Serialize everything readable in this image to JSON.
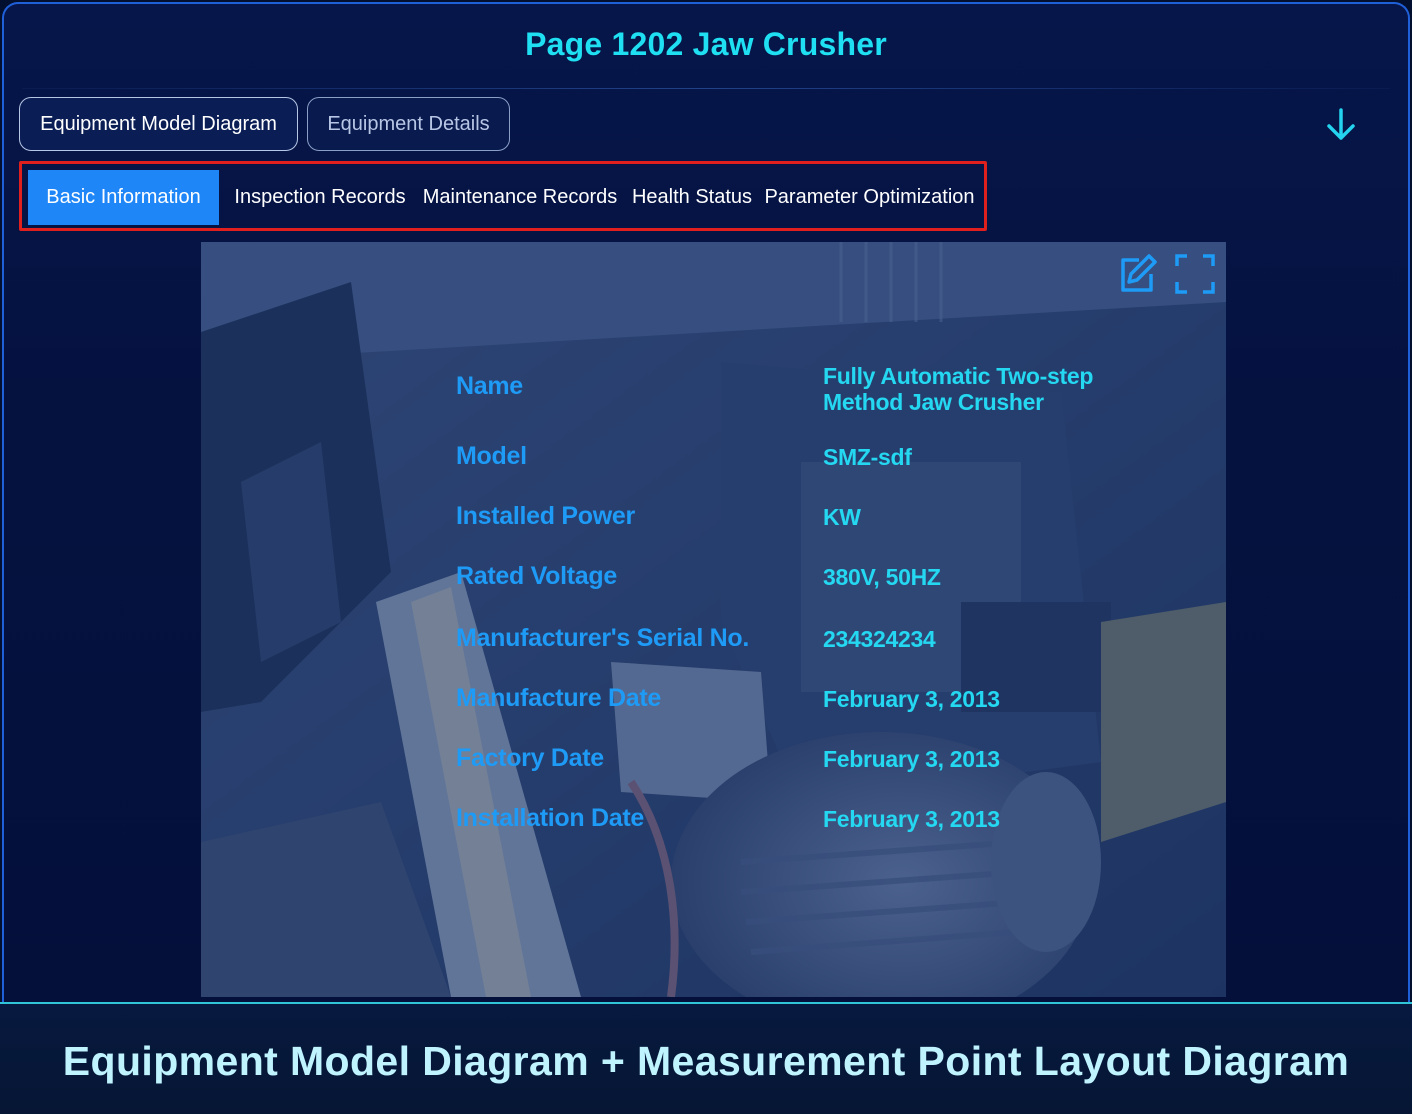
{
  "header": {
    "title": "Page 1202 Jaw Crusher"
  },
  "top_tabs": [
    {
      "label": "Equipment Model Diagram",
      "active": true
    },
    {
      "label": "Equipment Details",
      "active": false
    }
  ],
  "sub_tabs": [
    {
      "label": "Basic Information",
      "active": true
    },
    {
      "label": "Inspection Records",
      "active": false
    },
    {
      "label": "Maintenance Records",
      "active": false
    },
    {
      "label": "Health Status",
      "active": false
    },
    {
      "label": "Parameter Optimization",
      "active": false
    }
  ],
  "icons": {
    "download": "arrow-down-icon",
    "edit": "edit-icon",
    "fullscreen": "fullscreen-icon"
  },
  "info": {
    "name": {
      "label": "Name",
      "value_line1": "Fully Automatic Two-step",
      "value_line2": "Method Jaw Crusher"
    },
    "model": {
      "label": "Model",
      "value": "SMZ-sdf"
    },
    "installed_power": {
      "label": "Installed Power",
      "value": "KW"
    },
    "rated_voltage": {
      "label": "Rated Voltage",
      "value": "380V, 50HZ"
    },
    "serial_no": {
      "label": "Manufacturer's Serial No.",
      "value": "234324234"
    },
    "manufacture_date": {
      "label": "Manufacture Date",
      "value": "February 3, 2013"
    },
    "factory_date": {
      "label": "Factory Date",
      "value": "February 3, 2013"
    },
    "installation_date": {
      "label": "Installation Date",
      "value": "February 3, 2013"
    }
  },
  "caption": "Equipment Model Diagram + Measurement Point Layout Diagram",
  "colors": {
    "accent": "#1e86f7",
    "title": "#1fe0f2",
    "label": "#1e9bf6",
    "value": "#25d8f2",
    "highlight_border": "#e0201c"
  }
}
